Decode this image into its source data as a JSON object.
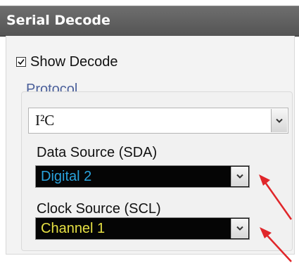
{
  "window": {
    "title": "Serial Decode"
  },
  "show_decode": {
    "label": "Show Decode",
    "checked": true
  },
  "protocol": {
    "label": "Protocol",
    "value": "I²C"
  },
  "data_source": {
    "label": "Data Source (SDA)",
    "value": "Digital 2",
    "value_color": "#2aa4de"
  },
  "clock_source": {
    "label": "Clock Source (SCL)",
    "value": "Channel 1",
    "value_color": "#e6e043"
  },
  "icons": {
    "checkbox": "checkmark-icon",
    "dropdown": "chevron-down-icon",
    "annotation": "red-arrow-icon"
  },
  "colors": {
    "titlebar": "#5f5f5f",
    "protocol_label": "#4a5f9a",
    "annotation_arrow": "#e0262a"
  }
}
